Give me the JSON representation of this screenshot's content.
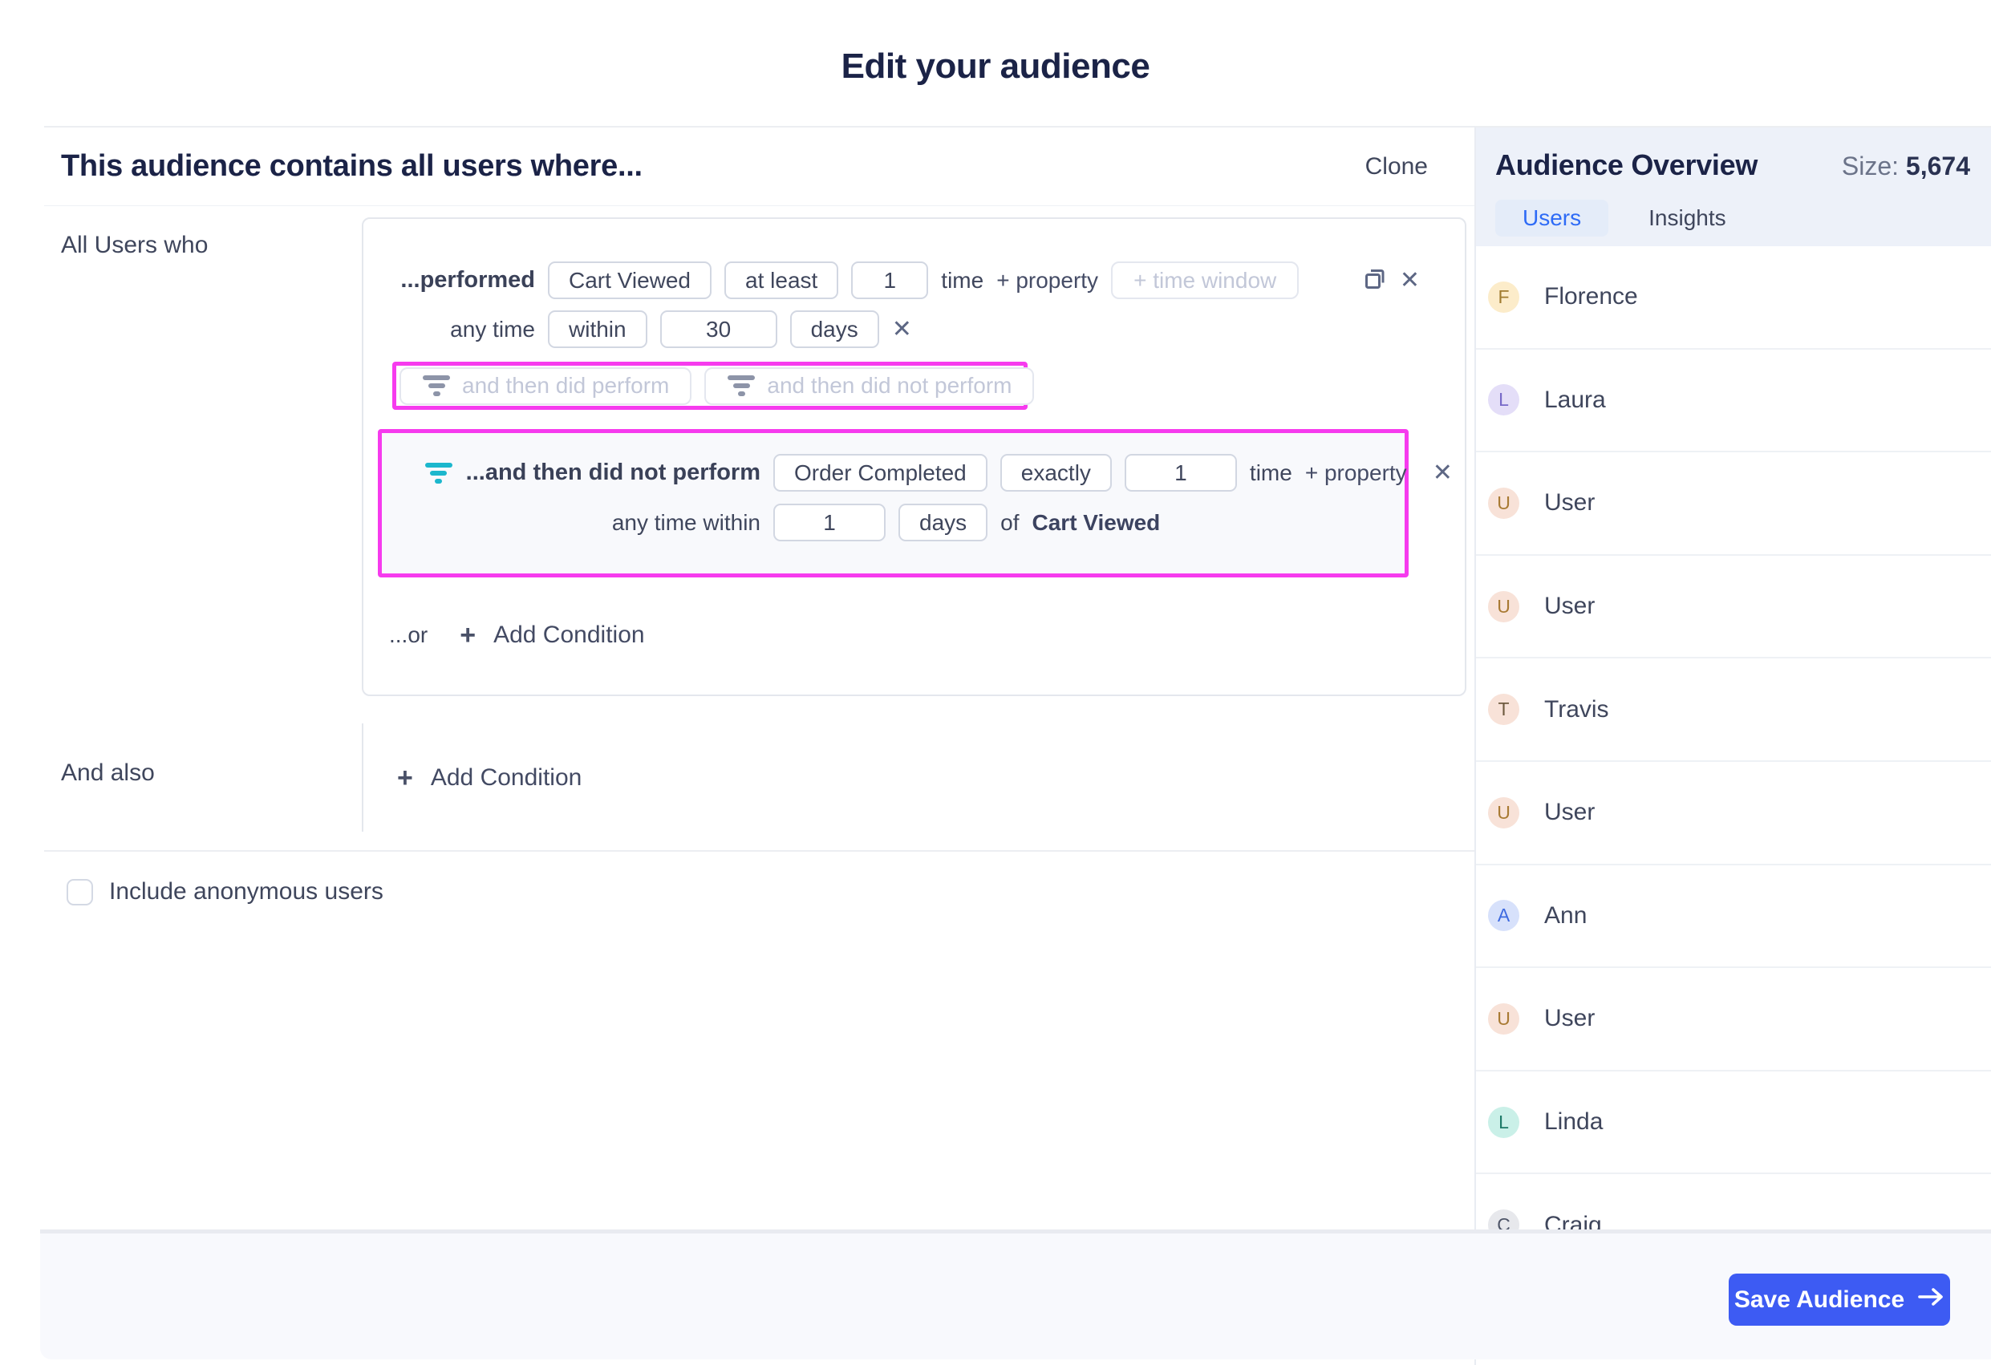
{
  "page": {
    "title": "Edit your audience"
  },
  "builder": {
    "heading": "This audience contains all users where...",
    "clone_label": "Clone",
    "section1_label": "All Users who",
    "section2_label": "And also",
    "or_label": "...or",
    "add_condition_label": "Add Condition",
    "include_anonymous_label": "Include anonymous users",
    "condition1": {
      "prefix": "...performed",
      "event": "Cart Viewed",
      "operator": "at least",
      "count": "1",
      "count_suffix": "time",
      "add_property_label": "+ property",
      "time_window_placeholder": "+ time window",
      "time_row": {
        "prefix": "any time",
        "modifier": "within",
        "value": "30",
        "unit": "days"
      }
    },
    "ghost_buttons": [
      {
        "label": "and then did perform"
      },
      {
        "label": "and then did not perform"
      }
    ],
    "condition2": {
      "prefix": "...and then did not perform",
      "event": "Order Completed",
      "operator": "exactly",
      "count": "1",
      "count_suffix": "time",
      "add_property_label": "+ property",
      "time_row": {
        "prefix": "any time within",
        "value": "1",
        "unit": "days",
        "of_label": "of",
        "of_event": "Cart Viewed"
      }
    }
  },
  "sidebar": {
    "title": "Audience Overview",
    "size_label": "Size:",
    "size_value": "5,674",
    "tabs": [
      {
        "label": "Users"
      },
      {
        "label": "Insights"
      }
    ],
    "users": [
      {
        "name": "Florence",
        "initial": "F",
        "bg": "#fcecca",
        "fg": "#a07b2f"
      },
      {
        "name": "Laura",
        "initial": "L",
        "bg": "#e4def8",
        "fg": "#7668c8"
      },
      {
        "name": "User",
        "initial": "U",
        "bg": "#f8e2d8",
        "fg": "#a87a33"
      },
      {
        "name": "User",
        "initial": "U",
        "bg": "#f8e2d8",
        "fg": "#a87a33"
      },
      {
        "name": "Travis",
        "initial": "T",
        "bg": "#f8e2d8",
        "fg": "#6e5a3f"
      },
      {
        "name": "User",
        "initial": "U",
        "bg": "#f8e2d8",
        "fg": "#a87a33"
      },
      {
        "name": "Ann",
        "initial": "A",
        "bg": "#d7e1fb",
        "fg": "#3e6ae0"
      },
      {
        "name": "User",
        "initial": "U",
        "bg": "#f8e2d8",
        "fg": "#a87a33"
      },
      {
        "name": "Linda",
        "initial": "L",
        "bg": "#caf0e8",
        "fg": "#1d7a68"
      },
      {
        "name": "Craig",
        "initial": "C",
        "bg": "#e7e8ec",
        "fg": "#4e5568"
      }
    ]
  },
  "footer": {
    "save_label": "Save Audience"
  },
  "colors": {
    "accent_blue": "#3d5bf3",
    "highlight_magenta": "#f63bee",
    "filter_teal": "#1cb7cd",
    "active_tab_bg": "#e4ecf9",
    "active_tab_text": "#2e6bf6"
  }
}
